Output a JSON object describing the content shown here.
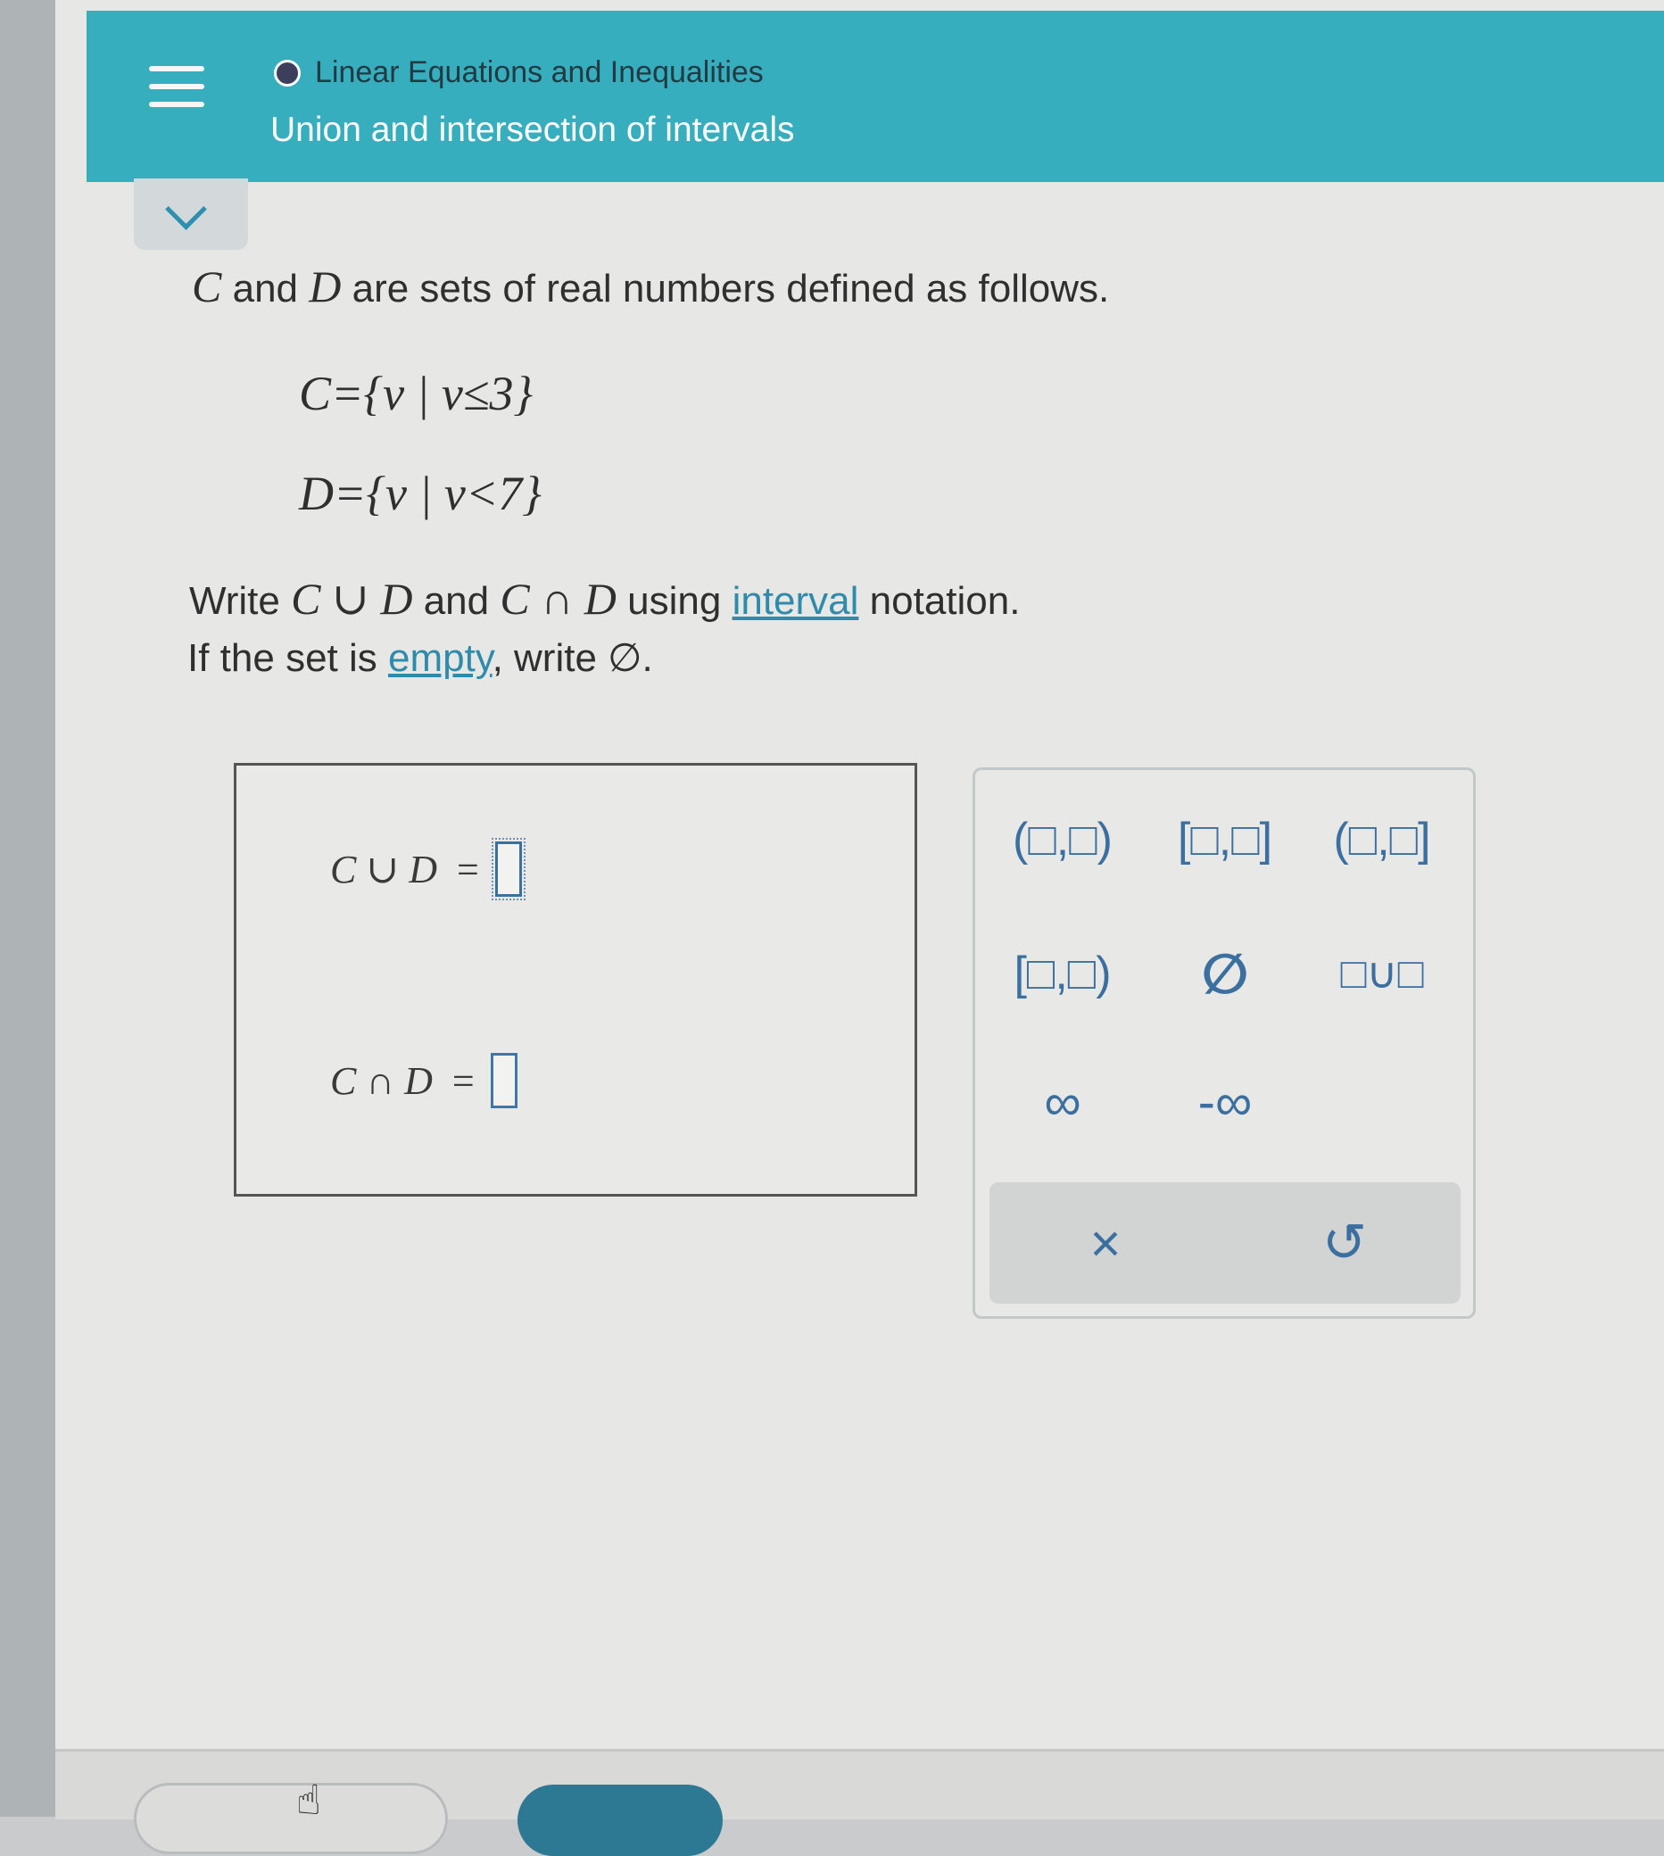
{
  "header": {
    "topic": "Linear Equations and Inequalities",
    "lesson": "Union and intersection of intervals"
  },
  "question": {
    "intro_tail": "are sets of real numbers defined as follows.",
    "and": "and",
    "var_c": "C",
    "var_d": "D",
    "set_c_lhs": "C",
    "set_c_body": "={v | v≤3}",
    "set_d_lhs": "D",
    "set_d_body": "={v | v<7}",
    "write": "Write",
    "union_expr": "C ∪ D",
    "intersect_expr": "C ∩ D",
    "using": "using",
    "interval_link": "interval",
    "notation": "notation.",
    "empty_prefix": "If the set is",
    "empty_link": "empty",
    "empty_suffix": ", write ∅."
  },
  "answers": {
    "union_label": "C ∪ D",
    "intersect_label": "C ∩ D",
    "equals": "="
  },
  "keypad": {
    "keys": [
      "(□,□)",
      "[□,□]",
      "(□,□]",
      "[□,□)",
      "∅",
      "□∪□",
      "∞",
      "-∞"
    ],
    "clear_symbol": "×",
    "undo_symbol": "↺"
  },
  "colors": {
    "header": "#36aebd",
    "accent": "#3b6fa0",
    "link": "#2f8bab"
  }
}
